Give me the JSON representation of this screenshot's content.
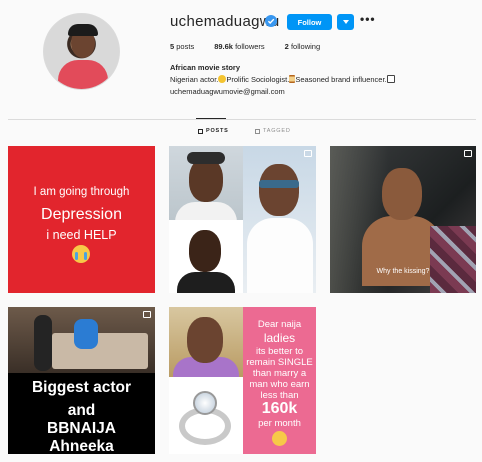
{
  "profile": {
    "username": "uchemaduagwu",
    "follow_label": "Follow",
    "more_label": "•••",
    "stats": {
      "posts_count": "5",
      "posts_label": "posts",
      "followers_count": "89.6k",
      "followers_label": "followers",
      "following_count": "2",
      "following_label": "following"
    },
    "bio": {
      "name": "African movie story",
      "part1": "Nigerian actor.",
      "part2": "Prolific Sociologist.",
      "part3": "Seasoned brand influencer.",
      "email": "uchemaduagwumovie@gmail.com"
    }
  },
  "tabs": {
    "posts": "POSTS",
    "tagged": "TAGGED"
  },
  "posts": [
    {
      "lines": [
        "I am going through",
        "Depression",
        "i need HELP"
      ]
    },
    {
      "lines": []
    },
    {
      "caption": "Why the kissing?"
    },
    {
      "lines": [
        "Biggest actor",
        "and",
        "BBNAIJA",
        "Ahneeka"
      ]
    },
    {
      "lines": [
        "Dear naija",
        "ladies",
        "its better to",
        "remain SINGLE",
        "than marry a",
        "man who earn",
        "less than",
        "160k",
        "per month"
      ]
    }
  ],
  "colors": {
    "accent": "#0095f6",
    "post1_bg": "#e2252d",
    "post5_pink": "#ec6a92"
  }
}
